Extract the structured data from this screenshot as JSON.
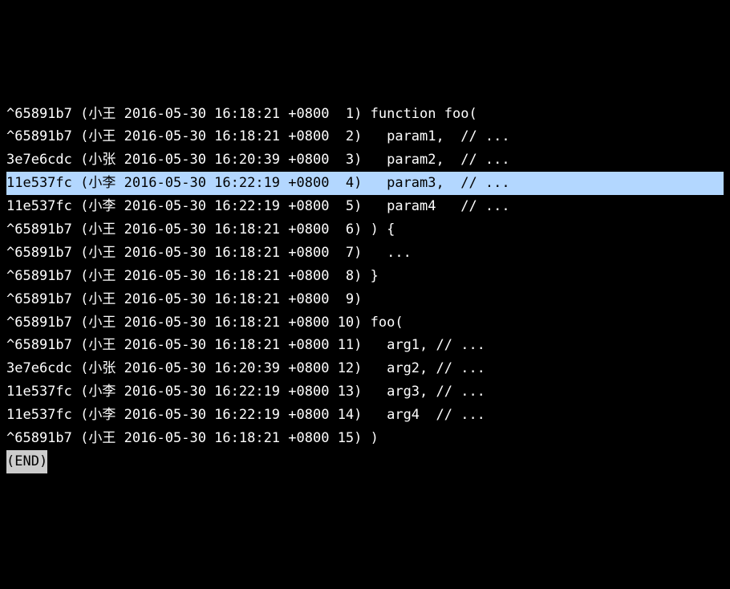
{
  "lines": [
    {
      "highlighted": false,
      "text": "^65891b7 (小王 2016-05-30 16:18:21 +0800  1) function foo("
    },
    {
      "highlighted": false,
      "text": "^65891b7 (小王 2016-05-30 16:18:21 +0800  2)   param1,  // ..."
    },
    {
      "highlighted": false,
      "text": "3e7e6cdc (小张 2016-05-30 16:20:39 +0800  3)   param2,  // ..."
    },
    {
      "highlighted": true,
      "text": "11e537fc (小李 2016-05-30 16:22:19 +0800  4)   param3,  // ..."
    },
    {
      "highlighted": false,
      "text": "11e537fc (小李 2016-05-30 16:22:19 +0800  5)   param4   // ..."
    },
    {
      "highlighted": false,
      "text": "^65891b7 (小王 2016-05-30 16:18:21 +0800  6) ) {"
    },
    {
      "highlighted": false,
      "text": "^65891b7 (小王 2016-05-30 16:18:21 +0800  7)   ..."
    },
    {
      "highlighted": false,
      "text": "^65891b7 (小王 2016-05-30 16:18:21 +0800  8) }"
    },
    {
      "highlighted": false,
      "text": "^65891b7 (小王 2016-05-30 16:18:21 +0800  9)"
    },
    {
      "highlighted": false,
      "text": "^65891b7 (小王 2016-05-30 16:18:21 +0800 10) foo("
    },
    {
      "highlighted": false,
      "text": "^65891b7 (小王 2016-05-30 16:18:21 +0800 11)   arg1, // ..."
    },
    {
      "highlighted": false,
      "text": "3e7e6cdc (小张 2016-05-30 16:20:39 +0800 12)   arg2, // ..."
    },
    {
      "highlighted": false,
      "text": "11e537fc (小李 2016-05-30 16:22:19 +0800 13)   arg3, // ..."
    },
    {
      "highlighted": false,
      "text": "11e537fc (小李 2016-05-30 16:22:19 +0800 14)   arg4  // ..."
    },
    {
      "highlighted": false,
      "text": "^65891b7 (小王 2016-05-30 16:18:21 +0800 15) )"
    }
  ],
  "end_marker": "(END)"
}
